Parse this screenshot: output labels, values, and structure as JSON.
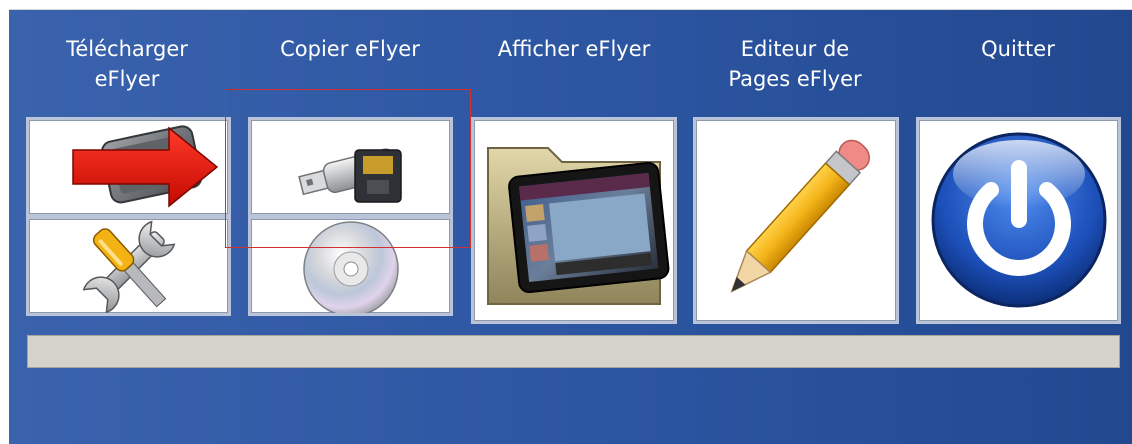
{
  "toolbar": {
    "download": {
      "label": "Télécharger\neFlyer"
    },
    "copy": {
      "label": "Copier eFlyer"
    },
    "view": {
      "label": "Afficher eFlyer"
    },
    "editor": {
      "label": "Editeur de\nPages eFlyer"
    },
    "quit": {
      "label": "Quitter"
    }
  },
  "progress": {
    "fraction": 0
  },
  "icons": {
    "download_top": "device-with-red-arrow-icon",
    "download_bottom": "tools-wrench-screwdriver-icon",
    "copy_top": "usb-and-sd-card-icon",
    "copy_bottom": "cd-disc-icon",
    "view": "folder-with-tablet-icon",
    "editor": "pencil-icon",
    "quit": "power-button-icon"
  },
  "colors": {
    "background": "#2c55a1",
    "selection_outline": "#d23030",
    "progress_track": "#d6d3cb"
  }
}
